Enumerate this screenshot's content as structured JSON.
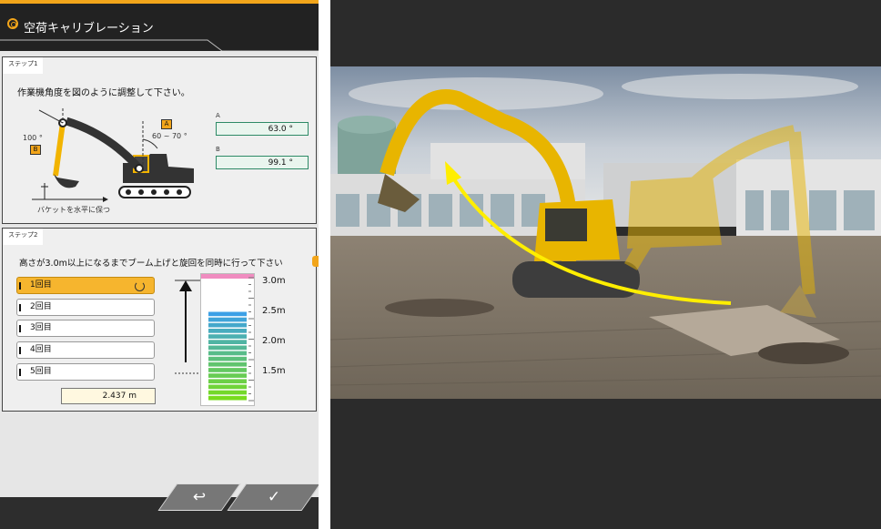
{
  "header": {
    "title": "空荷キャリブレーション"
  },
  "step1": {
    "label": "ステップ1",
    "instruction": "作業機角度を図のように調整して下さい。",
    "diagram": {
      "angle_boom": "60 ~ 70 °",
      "angle_arm": "100 °",
      "marker_a": "A",
      "marker_b": "B",
      "bucket_caption": "バケットを水平に保つ"
    },
    "values": [
      {
        "label": "A",
        "value": "63.0 °"
      },
      {
        "label": "B",
        "value": "99.1 °"
      }
    ]
  },
  "step2": {
    "label": "ステップ2",
    "instruction": "高さが3.0m以上になるまでブーム上げと旋回を同時に行って下さい",
    "counts": [
      "1回目",
      "2回目",
      "3回目",
      "4回目",
      "5回目"
    ],
    "active_index": 0,
    "current_height": "2.437 m",
    "current_height_m": 2.437,
    "scale": [
      "3.0m",
      "2.5m",
      "2.0m",
      "1.5m"
    ],
    "target_color": "#f08cc0"
  },
  "buttons": {
    "back_icon": "return-icon",
    "confirm_icon": "check-icon"
  },
  "colors": {
    "accent": "#f2a51a",
    "title_bar": "#222222"
  }
}
